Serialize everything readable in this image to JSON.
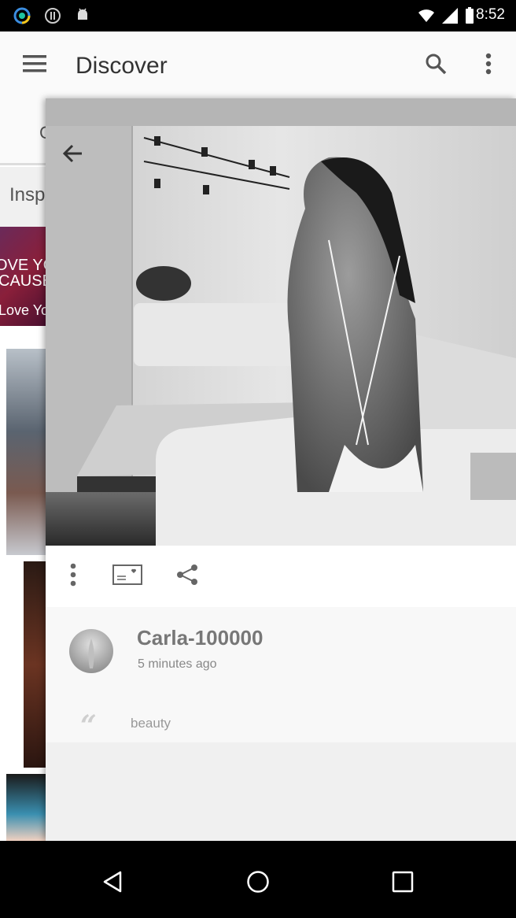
{
  "status_bar": {
    "time": "8:52"
  },
  "app_bar": {
    "title": "Discover"
  },
  "background": {
    "tab_fragment": "C",
    "section_fragment": "Insp",
    "card_text_1": "OVE YO",
    "card_text_2": "CAUSE",
    "card_text_3": "Love Yo"
  },
  "post": {
    "author": "Carla-100000",
    "time": "5 minutes ago",
    "quote_mark": "“",
    "caption": "beauty"
  },
  "colors": {
    "appbar_bg": "#fafafa",
    "title_text": "#333333",
    "author_text": "#777777",
    "statusbar_bg": "#000000",
    "navbar_bg": "#000000"
  },
  "icons": {
    "menu": "hamburger-icon",
    "search": "search-icon",
    "more": "more-vert-icon",
    "back": "arrow-back-icon",
    "postcard": "postcard-heart-icon",
    "share": "share-icon"
  }
}
